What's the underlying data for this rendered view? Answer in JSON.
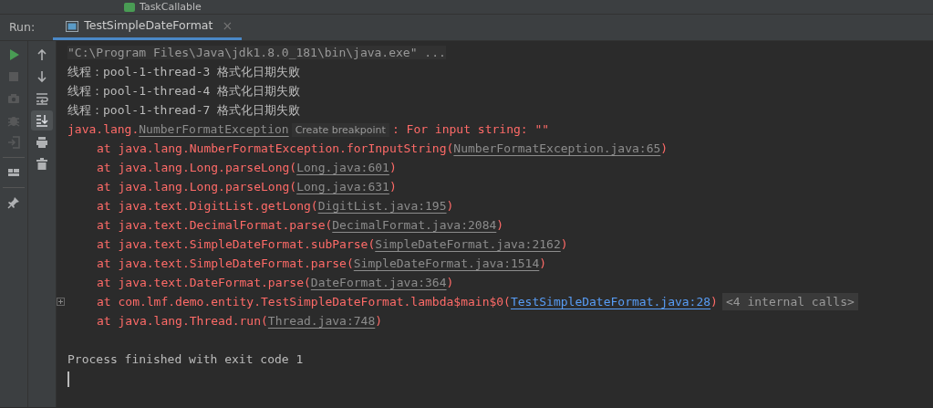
{
  "top_strip": {
    "label": "TaskCallable"
  },
  "run_panel": {
    "label": "Run:",
    "tabs": [
      {
        "title": "TestSimpleDateFormat",
        "close": "×",
        "selected": true
      }
    ]
  },
  "toolbar_left": [
    {
      "kind": "run",
      "disabled": false
    },
    {
      "kind": "stop",
      "disabled": true
    },
    {
      "kind": "camera",
      "disabled": true
    },
    {
      "kind": "bug",
      "disabled": true
    },
    {
      "kind": "exit",
      "disabled": true
    },
    {
      "kind": "sep"
    },
    {
      "kind": "layout",
      "disabled": false
    },
    {
      "kind": "sep"
    },
    {
      "kind": "pin",
      "disabled": false
    }
  ],
  "toolbar_right": [
    {
      "kind": "up",
      "selected": false
    },
    {
      "kind": "down",
      "selected": false
    },
    {
      "kind": "wrap",
      "selected": false
    },
    {
      "kind": "scroll-end",
      "selected": true
    },
    {
      "kind": "print",
      "selected": false
    },
    {
      "kind": "trash",
      "selected": false
    }
  ],
  "console": [
    {
      "kind": "command",
      "text": "\"C:\\Program Files\\Java\\jdk1.8.0_181\\bin\\java.exe\" ..."
    },
    {
      "kind": "plain",
      "text": "线程：pool-1-thread-3 格式化日期失败"
    },
    {
      "kind": "plain",
      "text": "线程：pool-1-thread-4 格式化日期失败"
    },
    {
      "kind": "plain",
      "text": "线程：pool-1-thread-7 格式化日期失败"
    },
    {
      "kind": "exception",
      "text": "java.lang.",
      "link": "NumberFormatException",
      "badge": "Create breakpoint",
      "tail": ": For input string: \"\""
    },
    {
      "kind": "frame",
      "text": "at java.lang.NumberFormatException.forInputString(",
      "link": "NumberFormatException.java:65",
      "in_project": false,
      "tail": ")"
    },
    {
      "kind": "frame",
      "text": "at java.lang.Long.parseLong(",
      "link": "Long.java:601",
      "in_project": false,
      "tail": ")"
    },
    {
      "kind": "frame",
      "text": "at java.lang.Long.parseLong(",
      "link": "Long.java:631",
      "in_project": false,
      "tail": ")"
    },
    {
      "kind": "frame",
      "text": "at java.text.DigitList.getLong(",
      "link": "DigitList.java:195",
      "in_project": false,
      "tail": ")"
    },
    {
      "kind": "frame",
      "text": "at java.text.DecimalFormat.parse(",
      "link": "DecimalFormat.java:2084",
      "in_project": false,
      "tail": ")"
    },
    {
      "kind": "frame",
      "text": "at java.text.SimpleDateFormat.subParse(",
      "link": "SimpleDateFormat.java:2162",
      "in_project": false,
      "tail": ")"
    },
    {
      "kind": "frame",
      "text": "at java.text.SimpleDateFormat.parse(",
      "link": "SimpleDateFormat.java:1514",
      "in_project": false,
      "tail": ")"
    },
    {
      "kind": "frame",
      "text": "at java.text.DateFormat.parse(",
      "link": "DateFormat.java:364",
      "in_project": false,
      "tail": ")"
    },
    {
      "kind": "frame",
      "text": "at com.lmf.demo.entity.TestSimpleDateFormat.lambda$main$0(",
      "link": "TestSimpleDateFormat.java:28",
      "in_project": true,
      "tail": ")",
      "folded": "<4 internal calls>"
    },
    {
      "kind": "frame",
      "text": "at java.lang.Thread.run(",
      "link": "Thread.java:748",
      "in_project": false,
      "tail": ")"
    },
    {
      "kind": "blank"
    },
    {
      "kind": "process",
      "text": "Process finished with exit code 1"
    },
    {
      "kind": "cursor"
    }
  ]
}
